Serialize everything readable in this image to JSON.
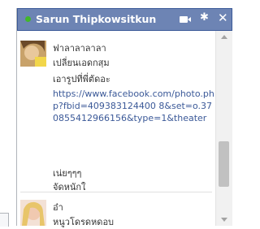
{
  "chat": {
    "contact_name": "Sarun Thipkowsitkun",
    "status": "online",
    "icons": [
      "video-call-icon",
      "gear-icon",
      "close-icon"
    ],
    "close_glyph": "✕",
    "gear_glyph": "✱"
  },
  "messages": [
    {
      "sender": "ฟาลาลาลาลา",
      "lines": [
        "เปลี่ยนเอดกสฺม",
        "เอารูปที่พี่ตัดอะ"
      ],
      "link": "https://www.facebook.com/photo.php?fbid=409383124400 8&set=o.370855412966156&type=1&theater",
      "after_lines": [
        "เน่ยๆๆๆ",
        "จัดหนักใ"
      ]
    },
    {
      "sender": "อ๋า",
      "lines": [
        "หนูวโดรดหดอบ"
      ]
    }
  ],
  "colors": {
    "titlebar": "#6d84b4",
    "titlebar_border": "#3b5998",
    "online_dot": "#42b72a",
    "link": "#3b5998"
  }
}
